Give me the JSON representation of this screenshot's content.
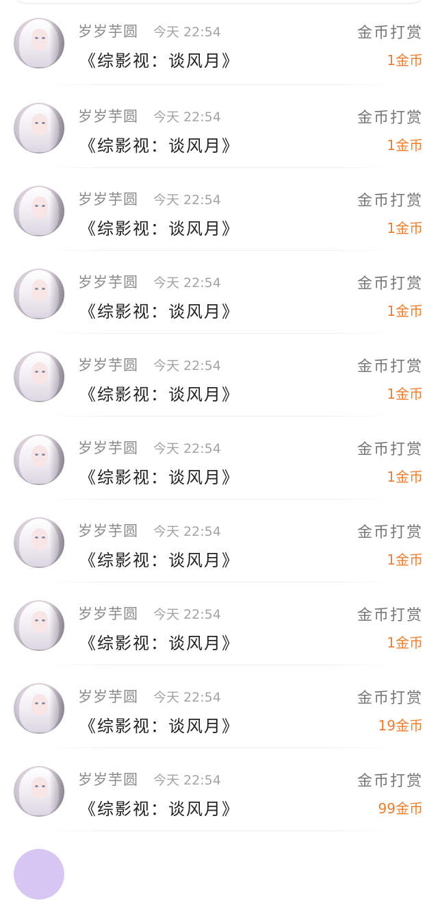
{
  "rows": [
    {
      "name": "岁岁芋圆",
      "time": "今天 22:54",
      "title": "《综影视：谈风月》",
      "action": "金币打赏",
      "amount": "1金币"
    },
    {
      "name": "岁岁芋圆",
      "time": "今天 22:54",
      "title": "《综影视：谈风月》",
      "action": "金币打赏",
      "amount": "1金币"
    },
    {
      "name": "岁岁芋圆",
      "time": "今天 22:54",
      "title": "《综影视：谈风月》",
      "action": "金币打赏",
      "amount": "1金币"
    },
    {
      "name": "岁岁芋圆",
      "time": "今天 22:54",
      "title": "《综影视：谈风月》",
      "action": "金币打赏",
      "amount": "1金币"
    },
    {
      "name": "岁岁芋圆",
      "time": "今天 22:54",
      "title": "《综影视：谈风月》",
      "action": "金币打赏",
      "amount": "1金币"
    },
    {
      "name": "岁岁芋圆",
      "time": "今天 22:54",
      "title": "《综影视：谈风月》",
      "action": "金币打赏",
      "amount": "1金币"
    },
    {
      "name": "岁岁芋圆",
      "time": "今天 22:54",
      "title": "《综影视：谈风月》",
      "action": "金币打赏",
      "amount": "1金币"
    },
    {
      "name": "岁岁芋圆",
      "time": "今天 22:54",
      "title": "《综影视：谈风月》",
      "action": "金币打赏",
      "amount": "1金币"
    },
    {
      "name": "岁岁芋圆",
      "time": "今天 22:54",
      "title": "《综影视：谈风月》",
      "action": "金币打赏",
      "amount": "19金币"
    },
    {
      "name": "岁岁芋圆",
      "time": "今天 22:54",
      "title": "《综影视：谈风月》",
      "action": "金币打赏",
      "amount": "99金币"
    }
  ],
  "colors": {
    "amount": "#f07c2c",
    "name": "#8a8a8a",
    "title": "#222222"
  }
}
